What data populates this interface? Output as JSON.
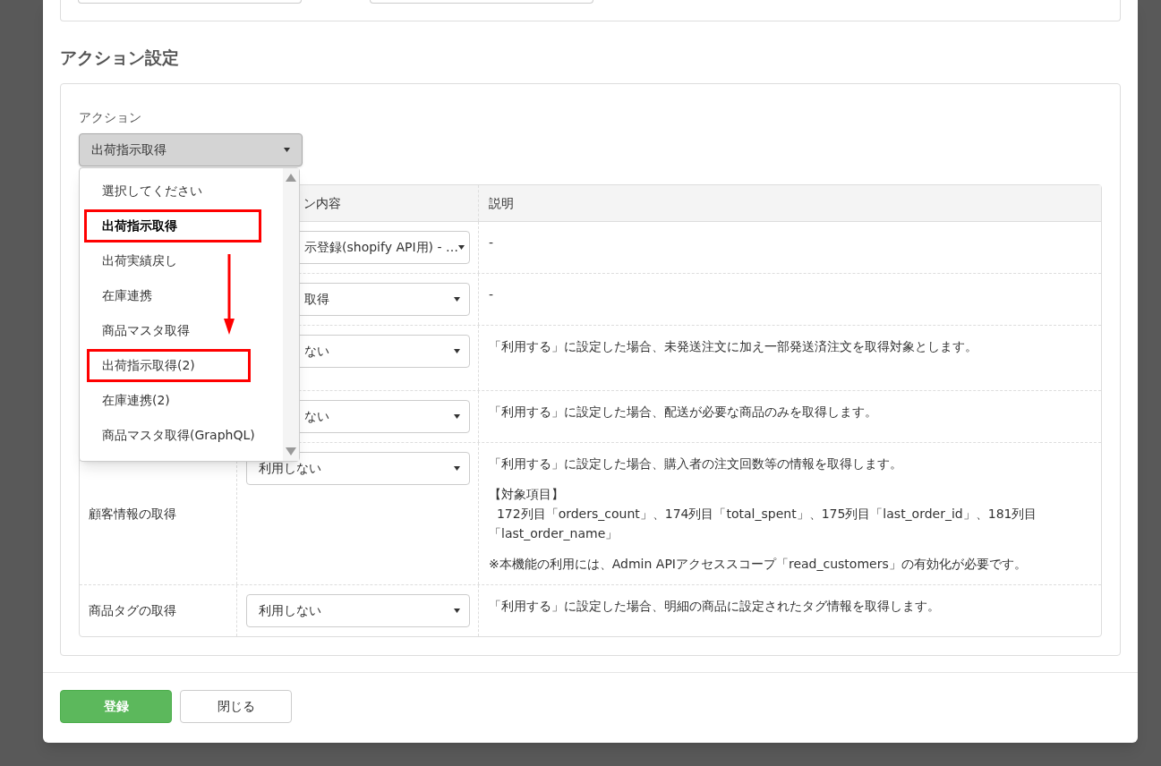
{
  "section_title": "アクション設定",
  "action": {
    "label": "アクション",
    "value": "出荷指示取得"
  },
  "dropdown": {
    "options": [
      {
        "label": "選択してください",
        "selected": false,
        "highlighted": false
      },
      {
        "label": "出荷指示取得",
        "selected": true,
        "highlighted": true
      },
      {
        "label": "出荷実績戻し",
        "selected": false,
        "highlighted": false
      },
      {
        "label": "在庫連携",
        "selected": false,
        "highlighted": false
      },
      {
        "label": "商品マスタ取得",
        "selected": false,
        "highlighted": false
      },
      {
        "label": "出荷指示取得(2)",
        "selected": false,
        "highlighted": true
      },
      {
        "label": "在庫連携(2)",
        "selected": false,
        "highlighted": false
      },
      {
        "label": "商品マスタ取得(GraphQL)",
        "selected": false,
        "highlighted": false
      }
    ]
  },
  "table": {
    "columns": [
      {
        "label": "ン内容",
        "partly_hidden": true
      },
      {
        "label": "説明"
      }
    ],
    "rows": [
      {
        "value": "示登録(shopify API用) - …",
        "partly_hidden": true,
        "description": [
          [
            "-"
          ]
        ]
      },
      {
        "value": "取得",
        "partly_hidden": true,
        "description": [
          [
            "-"
          ]
        ]
      },
      {
        "value": "ない",
        "partly_hidden": true,
        "description": [
          [
            "「利用する」に設定した場合、未発送注文に加え一部発送済注文を取得対象とします。"
          ]
        ]
      },
      {
        "value": "ない",
        "partly_hidden": true,
        "description": [
          [
            "「利用する」に設定した場合、配送が必要な商品のみを取得します。"
          ]
        ]
      },
      {
        "name": "顧客情報の取得",
        "value": "利用しない",
        "partly_hidden": false,
        "description": [
          [
            "「利用する」に設定した場合、購入者の注文回数等の情報を取得します。"
          ],
          [
            "【対象項目】",
            "  172列目「orders_count」、174列目「total_spent」、175列目「last_order_id」、181列目",
            "「last_order_name」"
          ],
          [
            "※本機能の利用には、Admin APIアクセススコープ「read_customers」の有効化が必要です。"
          ]
        ]
      },
      {
        "name": "商品タグの取得",
        "value": "利用しない",
        "partly_hidden": false,
        "description": [
          [
            "「利用する」に設定した場合、明細の商品に設定されたタグ情報を取得します。"
          ]
        ]
      }
    ]
  },
  "buttons": [
    {
      "label": "登録",
      "kind": "primary"
    },
    {
      "label": "閉じる",
      "kind": "secondary"
    }
  ]
}
